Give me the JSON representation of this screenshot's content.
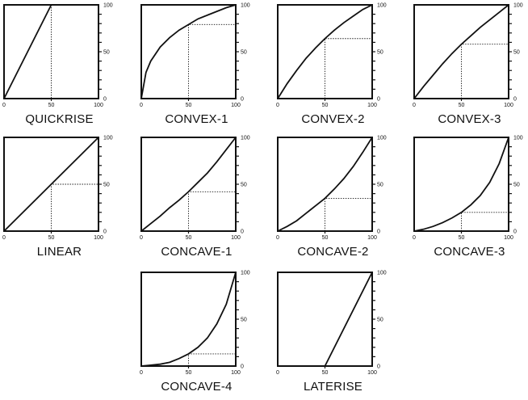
{
  "figure": {
    "curves": [
      {
        "name": "QUICKRISE",
        "x_ticks": [
          "0",
          "50",
          "100"
        ],
        "y_ticks": [
          "0",
          "50",
          "100"
        ],
        "guide": null,
        "points": [
          [
            0,
            0
          ],
          [
            50,
            100
          ],
          [
            100,
            100
          ]
        ]
      },
      {
        "name": "CONVEX-1",
        "x_ticks": [
          "0",
          "50",
          "100"
        ],
        "y_ticks": [
          "0",
          "50",
          "100"
        ],
        "guide": {
          "x": 50,
          "y": 79
        },
        "points": [
          [
            0,
            0
          ],
          [
            5,
            28
          ],
          [
            10,
            40
          ],
          [
            20,
            55
          ],
          [
            30,
            65
          ],
          [
            40,
            73
          ],
          [
            50,
            79
          ],
          [
            60,
            85
          ],
          [
            70,
            89
          ],
          [
            80,
            93
          ],
          [
            90,
            97
          ],
          [
            100,
            100
          ]
        ]
      },
      {
        "name": "CONVEX-2",
        "x_ticks": [
          "0",
          "50",
          "100"
        ],
        "y_ticks": [
          "0",
          "50",
          "100"
        ],
        "guide": {
          "x": 50,
          "y": 64
        },
        "points": [
          [
            0,
            0
          ],
          [
            10,
            16
          ],
          [
            20,
            30
          ],
          [
            30,
            43
          ],
          [
            40,
            54
          ],
          [
            50,
            64
          ],
          [
            60,
            73
          ],
          [
            70,
            81
          ],
          [
            80,
            88
          ],
          [
            90,
            95
          ],
          [
            100,
            100
          ]
        ]
      },
      {
        "name": "CONVEX-3",
        "x_ticks": [
          "0",
          "50",
          "100"
        ],
        "y_ticks": [
          "0",
          "50",
          "100"
        ],
        "guide": {
          "x": 50,
          "y": 58
        },
        "points": [
          [
            0,
            0
          ],
          [
            10,
            13
          ],
          [
            20,
            25
          ],
          [
            30,
            37
          ],
          [
            40,
            48
          ],
          [
            50,
            58
          ],
          [
            60,
            67
          ],
          [
            70,
            76
          ],
          [
            80,
            84
          ],
          [
            90,
            92
          ],
          [
            100,
            100
          ]
        ]
      },
      {
        "name": "LINEAR",
        "x_ticks": [
          "0",
          "50",
          "100"
        ],
        "y_ticks": [
          "0",
          "50",
          "100"
        ],
        "guide": {
          "x": 50,
          "y": 50
        },
        "points": [
          [
            0,
            0
          ],
          [
            100,
            100
          ]
        ]
      },
      {
        "name": "CONCAVE-1",
        "x_ticks": [
          "0",
          "50",
          "100"
        ],
        "y_ticks": [
          "0",
          "50",
          "100"
        ],
        "guide": {
          "x": 50,
          "y": 42
        },
        "points": [
          [
            0,
            0
          ],
          [
            10,
            8
          ],
          [
            20,
            16
          ],
          [
            30,
            25
          ],
          [
            40,
            33
          ],
          [
            50,
            42
          ],
          [
            60,
            52
          ],
          [
            70,
            62
          ],
          [
            80,
            74
          ],
          [
            90,
            87
          ],
          [
            100,
            100
          ]
        ]
      },
      {
        "name": "CONCAVE-2",
        "x_ticks": [
          "0",
          "50",
          "100"
        ],
        "y_ticks": [
          "0",
          "50",
          "100"
        ],
        "guide": {
          "x": 50,
          "y": 35
        },
        "points": [
          [
            0,
            0
          ],
          [
            10,
            5
          ],
          [
            20,
            11
          ],
          [
            30,
            19
          ],
          [
            40,
            27
          ],
          [
            50,
            35
          ],
          [
            60,
            45
          ],
          [
            70,
            56
          ],
          [
            80,
            69
          ],
          [
            90,
            84
          ],
          [
            100,
            100
          ]
        ]
      },
      {
        "name": "CONCAVE-3",
        "x_ticks": [
          "0",
          "50",
          "100"
        ],
        "y_ticks": [
          "0",
          "50",
          "100"
        ],
        "guide": {
          "x": 50,
          "y": 20
        },
        "points": [
          [
            0,
            0
          ],
          [
            10,
            2
          ],
          [
            20,
            5
          ],
          [
            30,
            9
          ],
          [
            40,
            14
          ],
          [
            50,
            20
          ],
          [
            60,
            28
          ],
          [
            70,
            38
          ],
          [
            80,
            52
          ],
          [
            90,
            72
          ],
          [
            100,
            100
          ]
        ]
      },
      {
        "name": "CONCAVE-4",
        "x_ticks": [
          "0",
          "50",
          "100"
        ],
        "y_ticks": [
          "0",
          "50",
          "100"
        ],
        "guide": {
          "x": 50,
          "y": 13
        },
        "points": [
          [
            0,
            0
          ],
          [
            10,
            1
          ],
          [
            20,
            2
          ],
          [
            30,
            4
          ],
          [
            40,
            8
          ],
          [
            50,
            13
          ],
          [
            60,
            20
          ],
          [
            70,
            30
          ],
          [
            80,
            45
          ],
          [
            90,
            66
          ],
          [
            100,
            100
          ]
        ]
      },
      {
        "name": "LATERISE",
        "x_ticks": [
          "0",
          "50",
          "100"
        ],
        "y_ticks": [
          "0",
          "50",
          "100"
        ],
        "guide": null,
        "points": [
          [
            0,
            0
          ],
          [
            50,
            0
          ],
          [
            100,
            100
          ]
        ]
      }
    ]
  },
  "chart_data": [
    {
      "type": "line",
      "title": "QUICKRISE",
      "xlim": [
        0,
        100
      ],
      "ylim": [
        0,
        100
      ],
      "grid": false,
      "x": [
        0,
        50,
        100
      ],
      "y": [
        0,
        100,
        100
      ]
    },
    {
      "type": "line",
      "title": "CONVEX-1",
      "xlim": [
        0,
        100
      ],
      "ylim": [
        0,
        100
      ],
      "grid": false,
      "x": [
        0,
        5,
        10,
        20,
        30,
        40,
        50,
        60,
        70,
        80,
        90,
        100
      ],
      "y": [
        0,
        28,
        40,
        55,
        65,
        73,
        79,
        85,
        89,
        93,
        97,
        100
      ]
    },
    {
      "type": "line",
      "title": "CONVEX-2",
      "xlim": [
        0,
        100
      ],
      "ylim": [
        0,
        100
      ],
      "grid": false,
      "x": [
        0,
        10,
        20,
        30,
        40,
        50,
        60,
        70,
        80,
        90,
        100
      ],
      "y": [
        0,
        16,
        30,
        43,
        54,
        64,
        73,
        81,
        88,
        95,
        100
      ]
    },
    {
      "type": "line",
      "title": "CONVEX-3",
      "xlim": [
        0,
        100
      ],
      "ylim": [
        0,
        100
      ],
      "grid": false,
      "x": [
        0,
        10,
        20,
        30,
        40,
        50,
        60,
        70,
        80,
        90,
        100
      ],
      "y": [
        0,
        13,
        25,
        37,
        48,
        58,
        67,
        76,
        84,
        92,
        100
      ]
    },
    {
      "type": "line",
      "title": "LINEAR",
      "xlim": [
        0,
        100
      ],
      "ylim": [
        0,
        100
      ],
      "grid": false,
      "x": [
        0,
        100
      ],
      "y": [
        0,
        100
      ]
    },
    {
      "type": "line",
      "title": "CONCAVE-1",
      "xlim": [
        0,
        100
      ],
      "ylim": [
        0,
        100
      ],
      "grid": false,
      "x": [
        0,
        10,
        20,
        30,
        40,
        50,
        60,
        70,
        80,
        90,
        100
      ],
      "y": [
        0,
        8,
        16,
        25,
        33,
        42,
        52,
        62,
        74,
        87,
        100
      ]
    },
    {
      "type": "line",
      "title": "CONCAVE-2",
      "xlim": [
        0,
        100
      ],
      "ylim": [
        0,
        100
      ],
      "grid": false,
      "x": [
        0,
        10,
        20,
        30,
        40,
        50,
        60,
        70,
        80,
        90,
        100
      ],
      "y": [
        0,
        5,
        11,
        19,
        27,
        35,
        45,
        56,
        69,
        84,
        100
      ]
    },
    {
      "type": "line",
      "title": "CONCAVE-3",
      "xlim": [
        0,
        100
      ],
      "ylim": [
        0,
        100
      ],
      "grid": false,
      "x": [
        0,
        10,
        20,
        30,
        40,
        50,
        60,
        70,
        80,
        90,
        100
      ],
      "y": [
        0,
        2,
        5,
        9,
        14,
        20,
        28,
        38,
        52,
        72,
        100
      ]
    },
    {
      "type": "line",
      "title": "CONCAVE-4",
      "xlim": [
        0,
        100
      ],
      "ylim": [
        0,
        100
      ],
      "grid": false,
      "x": [
        0,
        10,
        20,
        30,
        40,
        50,
        60,
        70,
        80,
        90,
        100
      ],
      "y": [
        0,
        1,
        2,
        4,
        8,
        13,
        20,
        30,
        45,
        66,
        100
      ]
    },
    {
      "type": "line",
      "title": "LATERISE",
      "xlim": [
        0,
        100
      ],
      "ylim": [
        0,
        100
      ],
      "grid": false,
      "x": [
        0,
        50,
        100
      ],
      "y": [
        0,
        0,
        100
      ]
    }
  ]
}
